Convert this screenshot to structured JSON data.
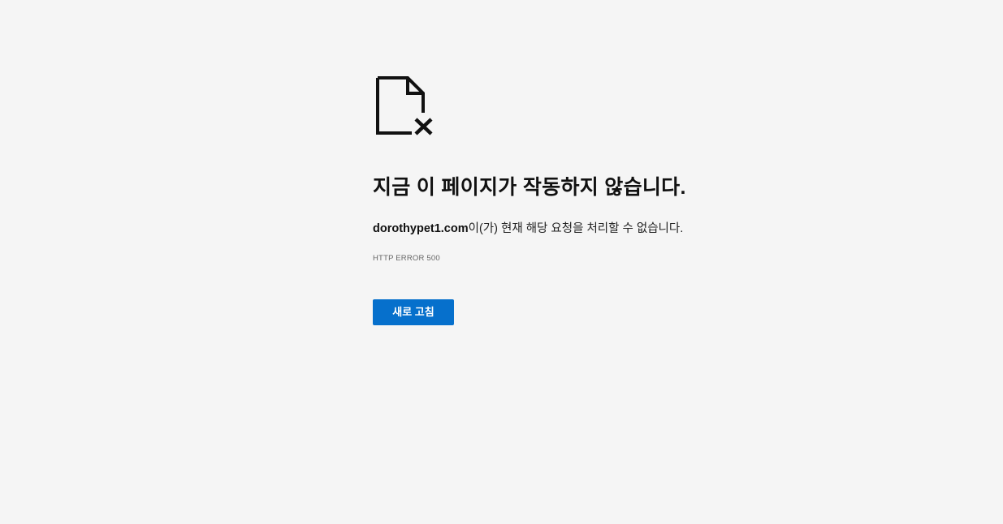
{
  "error_page": {
    "icon": "broken-document-icon",
    "headline": "지금 이 페이지가 작동하지 않습니다.",
    "domain": "dorothypet1.com",
    "message_suffix": "이(가) 현재 해당 요청을 처리할 수 없습니다.",
    "error_code": "HTTP ERROR 500",
    "reload_label": "새로 고침",
    "accent_color": "#0670cc",
    "background_color": "#f5f5f5"
  }
}
